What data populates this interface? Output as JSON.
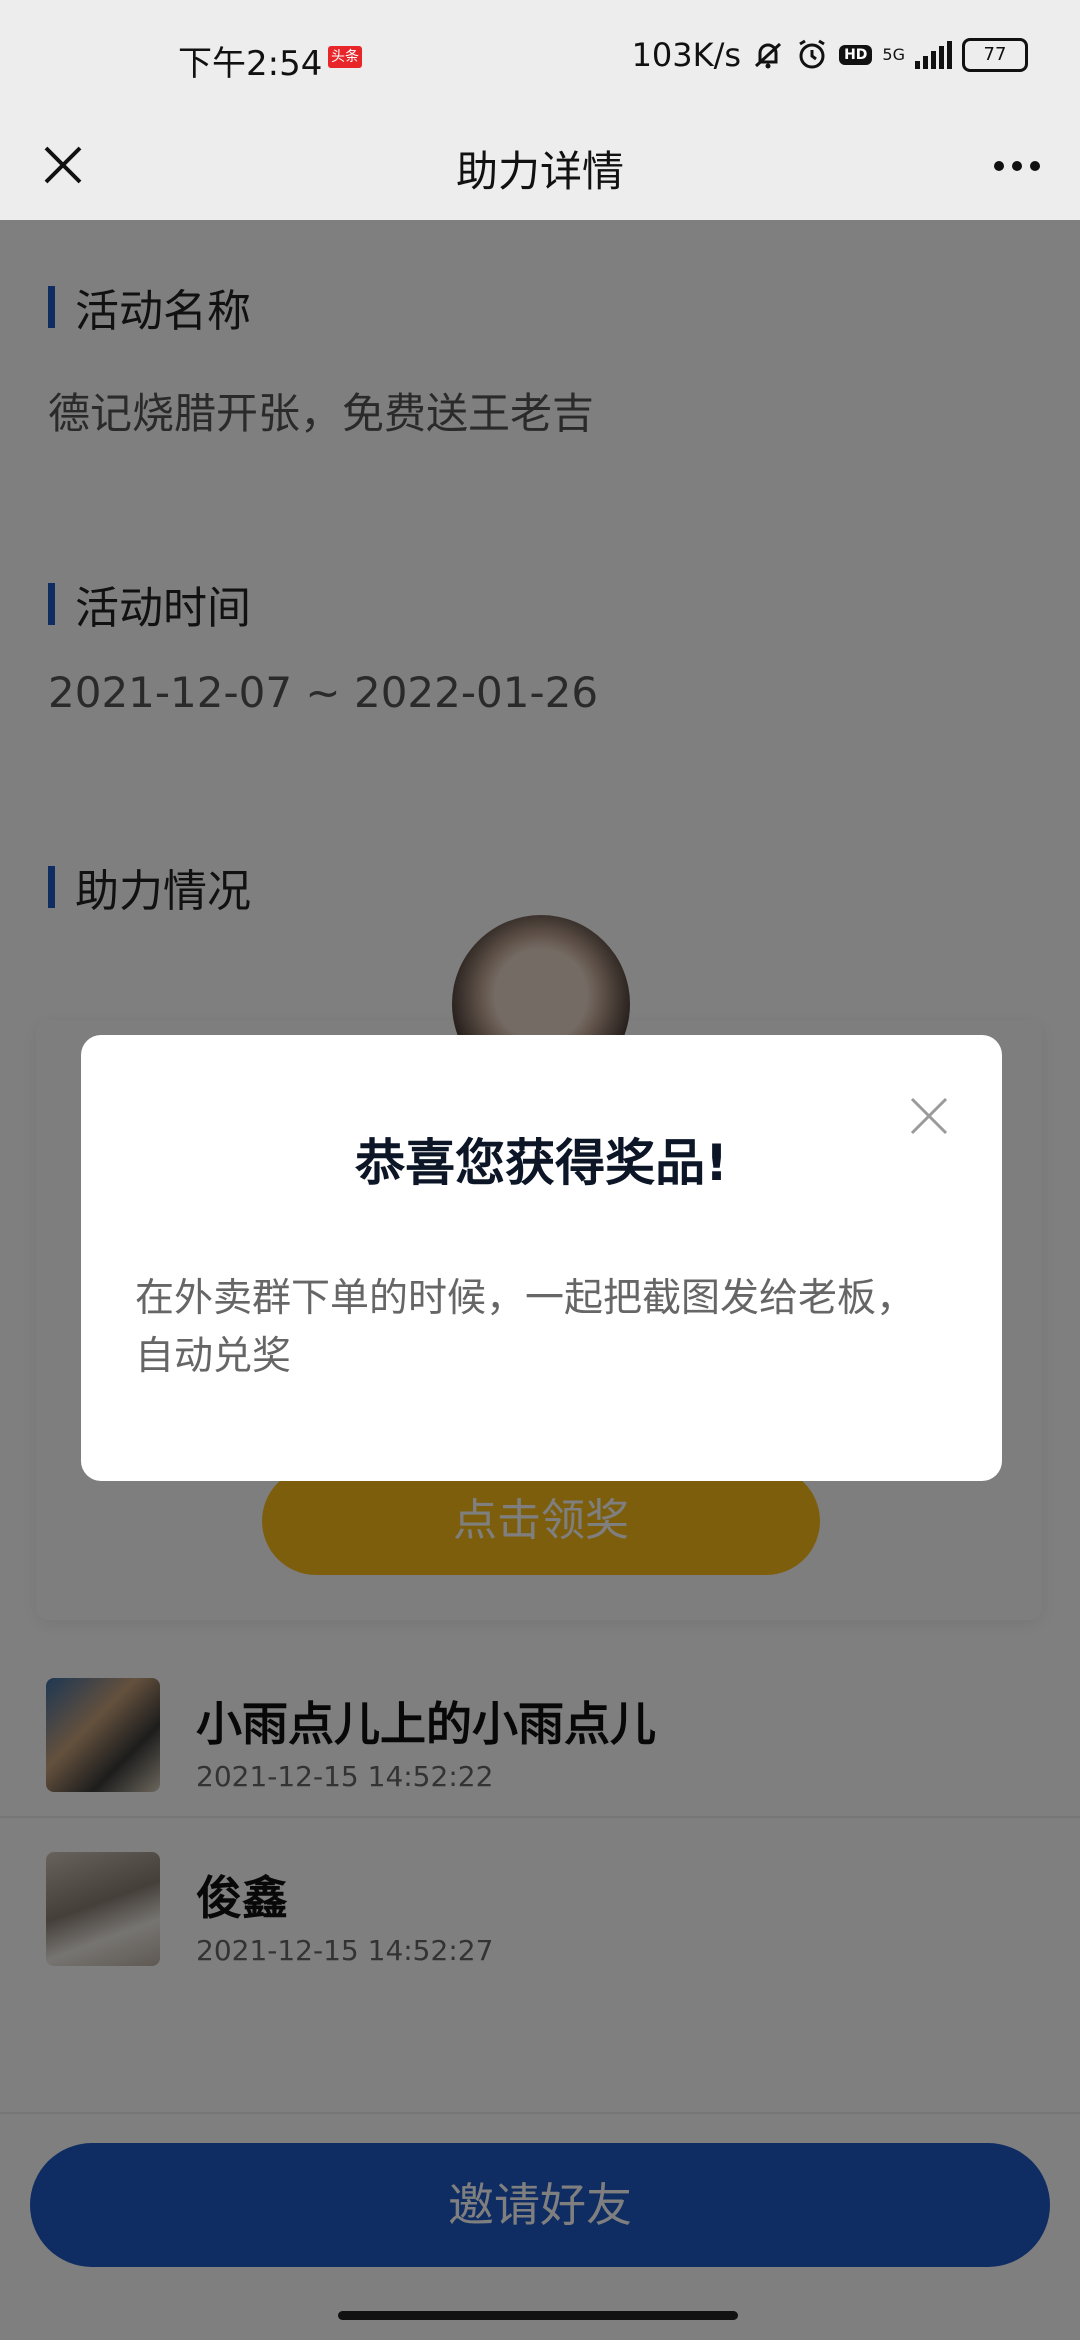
{
  "status_bar": {
    "time": "下午2:54",
    "app_badge": "头条",
    "net_speed": "103K/s",
    "hd": "HD",
    "network": "5G",
    "battery": "77"
  },
  "nav": {
    "title": "助力详情"
  },
  "activity": {
    "name_label": "活动名称",
    "name_value": "德记烧腊开张，免费送王老吉",
    "time_label": "活动时间",
    "time_value": "2021-12-07 ~ 2022-01-26",
    "progress_label": "助力情况"
  },
  "card": {
    "claim_label": "点击领奖"
  },
  "helpers": [
    {
      "name": "小雨点儿上的小雨点儿",
      "time": "2021-12-15 14:52:22"
    },
    {
      "name": "俊鑫",
      "time": "2021-12-15 14:52:27"
    }
  ],
  "footer": {
    "invite_label": "邀请好友"
  },
  "modal": {
    "title": "恭喜您获得奖品!",
    "body": "在外卖群下单的时候，一起把截图发给老板，自动兑奖"
  },
  "colors": {
    "accent_blue": "#1e5bc6",
    "claim_yellow": "#fbbd1b",
    "overlay": "rgba(0,0,0,0.5)"
  }
}
